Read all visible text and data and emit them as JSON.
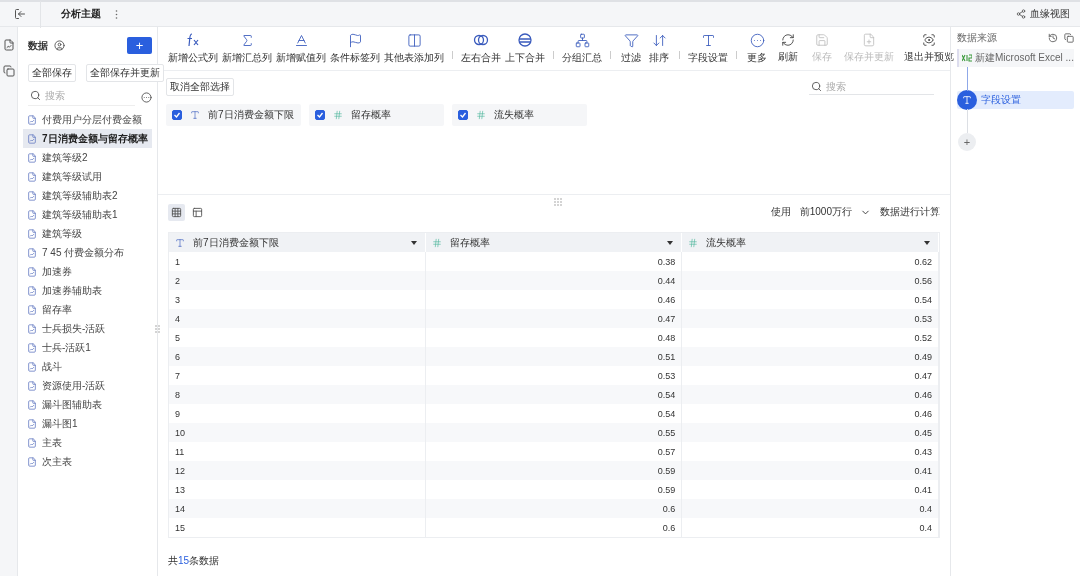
{
  "header": {
    "title": "分析主题",
    "lineage_link": "血缘视图"
  },
  "sidebar": {
    "title": "数据",
    "add_button": "+",
    "save_all": "全部保存",
    "save_all_update": "全部保存并更新",
    "search": {
      "placeholder": "搜索"
    },
    "items": [
      {
        "label": "付费用户分层付费金额",
        "selected": false
      },
      {
        "label": "7日消费金额与留存概率",
        "selected": true
      },
      {
        "label": "建筑等级2",
        "selected": false
      },
      {
        "label": "建筑等级试用",
        "selected": false
      },
      {
        "label": "建筑等级辅助表2",
        "selected": false
      },
      {
        "label": "建筑等级辅助表1",
        "selected": false
      },
      {
        "label": "建筑等级",
        "selected": false
      },
      {
        "label": "7 45 付费金额分布",
        "selected": false
      },
      {
        "label": "加速券",
        "selected": false
      },
      {
        "label": "加速券辅助表",
        "selected": false
      },
      {
        "label": "留存率",
        "selected": false
      },
      {
        "label": "士兵损失-活跃",
        "selected": false
      },
      {
        "label": "士兵-活跃1",
        "selected": false
      },
      {
        "label": "战斗",
        "selected": false
      },
      {
        "label": "资源使用-活跃",
        "selected": false
      },
      {
        "label": "漏斗图辅助表",
        "selected": false
      },
      {
        "label": "漏斗图1",
        "selected": false
      },
      {
        "label": "主表",
        "selected": false
      },
      {
        "label": "次主表",
        "selected": false
      }
    ]
  },
  "toolbar": {
    "groups": [
      [
        {
          "label": "新增公式列",
          "disabled": false
        },
        {
          "label": "新增汇总列",
          "disabled": false
        },
        {
          "label": "新增赋值列",
          "disabled": false
        },
        {
          "label": "条件标签列",
          "disabled": false
        },
        {
          "label": "其他表添加列",
          "disabled": false
        }
      ],
      [
        {
          "label": "左右合并",
          "disabled": false
        },
        {
          "label": "上下合并",
          "disabled": false
        }
      ],
      [
        {
          "label": "分组汇总",
          "disabled": false
        }
      ],
      [
        {
          "label": "过滤",
          "disabled": false
        },
        {
          "label": "排序",
          "disabled": false
        }
      ],
      [
        {
          "label": "字段设置",
          "disabled": false
        }
      ],
      [
        {
          "label": "更多",
          "disabled": false
        }
      ]
    ],
    "actions": [
      {
        "label": "刷新",
        "disabled": false
      },
      {
        "label": "保存",
        "disabled": true
      },
      {
        "label": "保存并更新",
        "disabled": true
      },
      {
        "label": "退出并预览",
        "disabled": false
      }
    ]
  },
  "fields": {
    "deselect_all": "取消全部选择",
    "search": {
      "placeholder": "搜索"
    },
    "items": [
      {
        "name": "前7日消费金额下限",
        "kind": "text",
        "checked": true
      },
      {
        "name": "留存概率",
        "kind": "number",
        "checked": true
      },
      {
        "name": "流失概率",
        "kind": "number",
        "checked": true
      }
    ]
  },
  "preview": {
    "views": [
      {
        "kind": "grid",
        "selected": true
      },
      {
        "kind": "layout",
        "selected": false
      }
    ],
    "use_label": "使用",
    "row_limit": "前1000万行",
    "compute_label": "数据进行计算",
    "table": {
      "columns": [
        {
          "name": "前7日消费金额下限",
          "kind": "text"
        },
        {
          "name": "留存概率",
          "kind": "number"
        },
        {
          "name": "流失概率",
          "kind": "number"
        }
      ],
      "rows": [
        [
          "1",
          "0.38",
          "0.62"
        ],
        [
          "2",
          "0.44",
          "0.56"
        ],
        [
          "3",
          "0.46",
          "0.54"
        ],
        [
          "4",
          "0.47",
          "0.53"
        ],
        [
          "5",
          "0.48",
          "0.52"
        ],
        [
          "6",
          "0.51",
          "0.49"
        ],
        [
          "7",
          "0.53",
          "0.47"
        ],
        [
          "8",
          "0.54",
          "0.46"
        ],
        [
          "9",
          "0.54",
          "0.46"
        ],
        [
          "10",
          "0.55",
          "0.45"
        ],
        [
          "11",
          "0.57",
          "0.43"
        ],
        [
          "12",
          "0.59",
          "0.41"
        ],
        [
          "13",
          "0.59",
          "0.41"
        ],
        [
          "14",
          "0.6",
          "0.4"
        ],
        [
          "15",
          "0.6",
          "0.4"
        ]
      ]
    },
    "total_prefix": "共",
    "total_count": "15",
    "total_suffix": "条数据"
  },
  "flow": {
    "title": "数据来源",
    "steps": [
      {
        "kind": "source",
        "label": "新建Microsoft Excel ...",
        "selected": false
      },
      {
        "kind": "step",
        "label": "字段设置",
        "selected": true
      }
    ],
    "add_button": "+"
  }
}
